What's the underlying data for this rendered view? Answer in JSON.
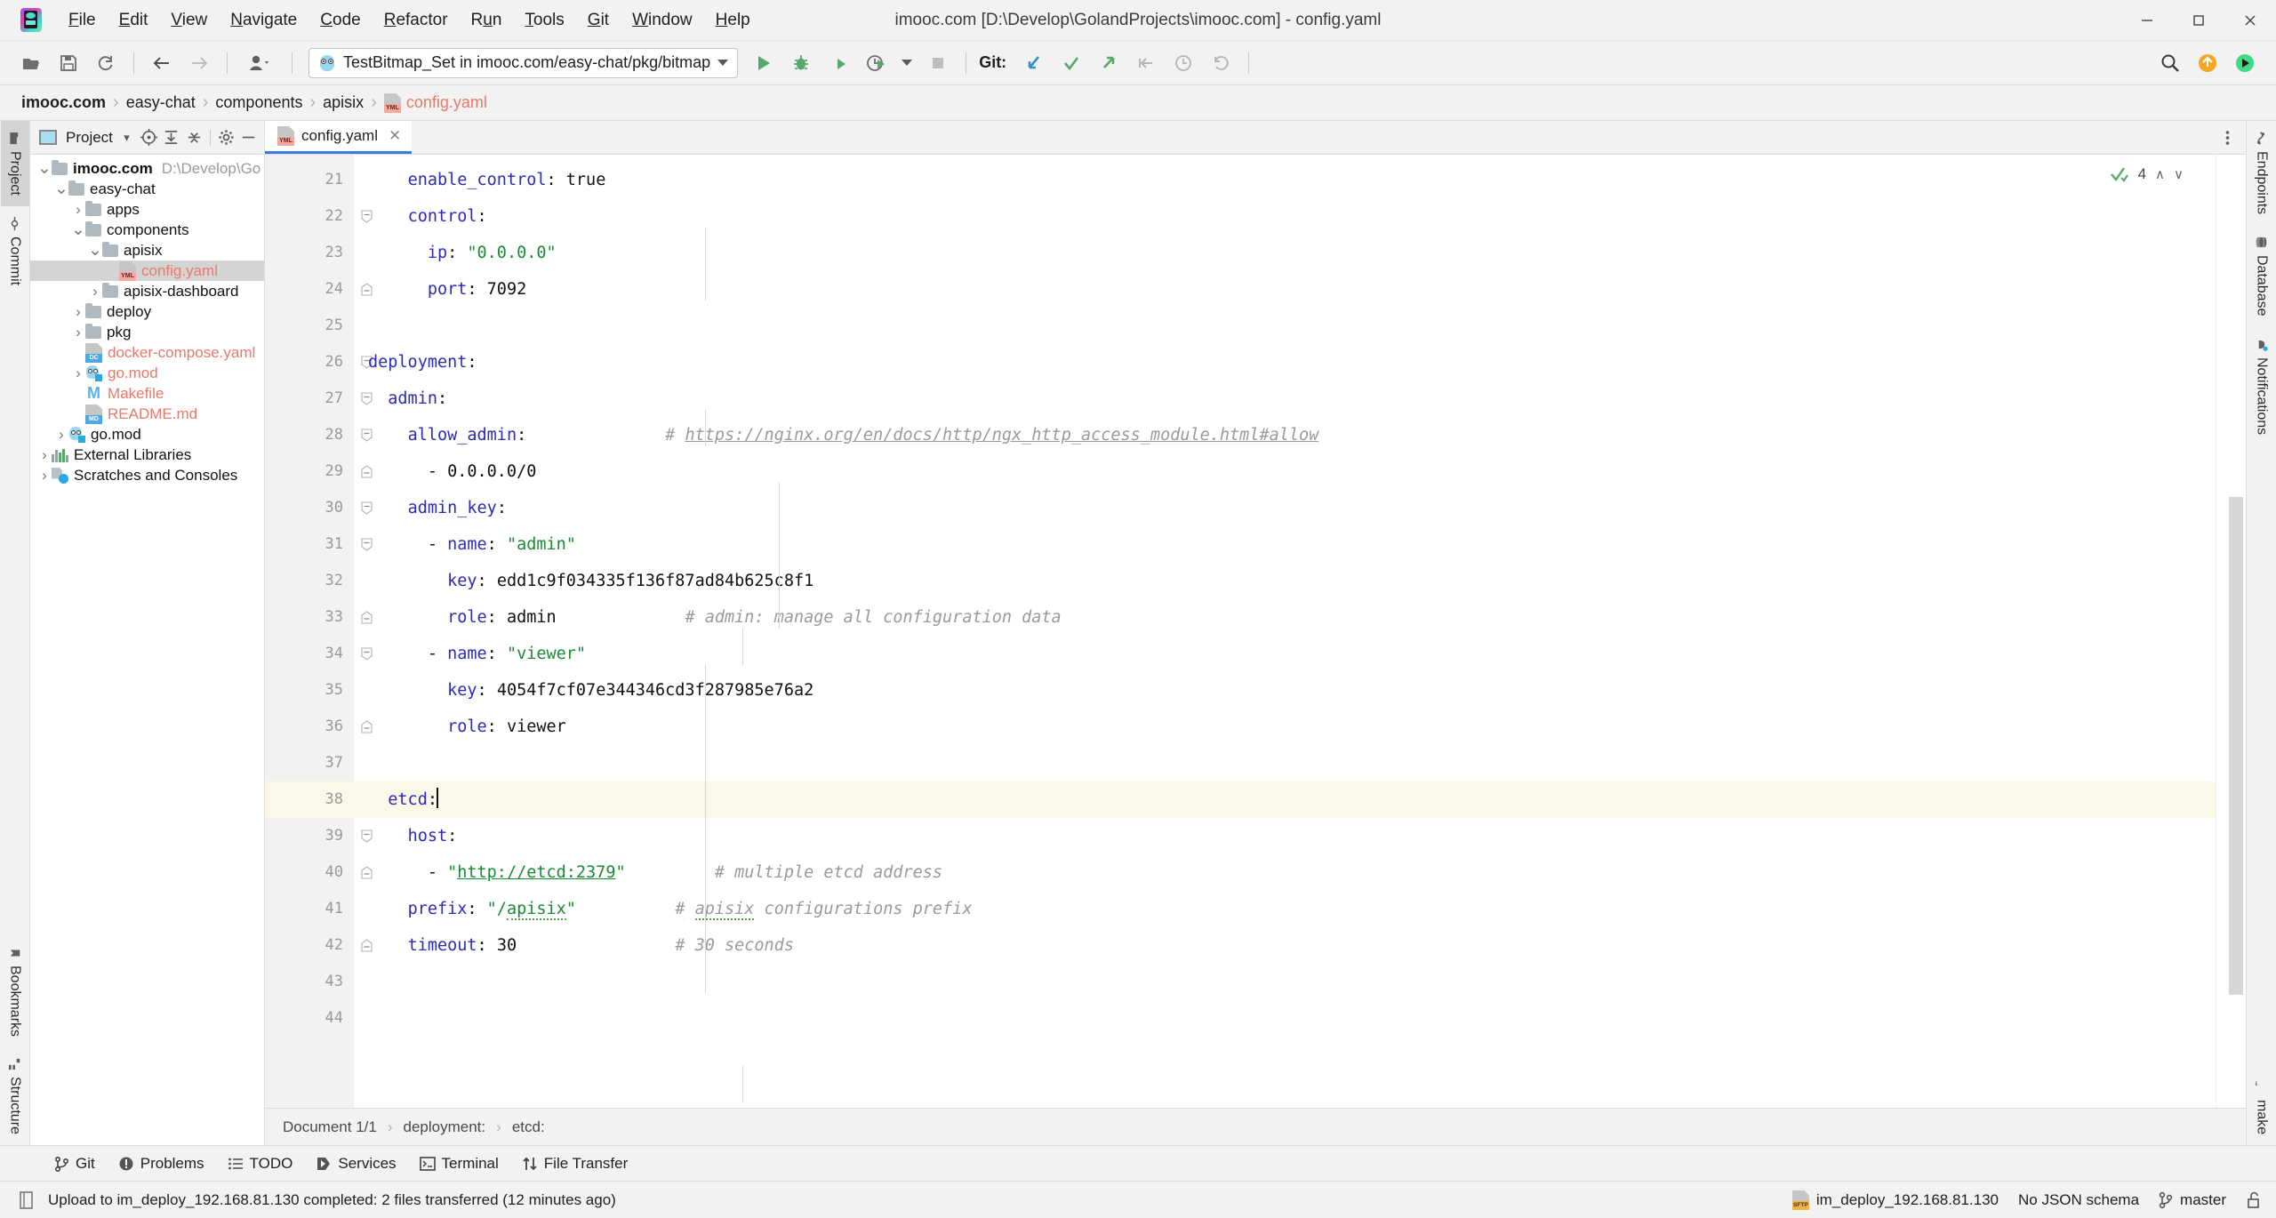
{
  "window": {
    "title": "imooc.com [D:\\Develop\\GolandProjects\\imooc.com] - config.yaml",
    "minimize": "─",
    "maximize": "❐",
    "close": "✕"
  },
  "menubar": {
    "items": [
      {
        "label": "File",
        "mnemonic": "F"
      },
      {
        "label": "Edit",
        "mnemonic": "E"
      },
      {
        "label": "View",
        "mnemonic": "V"
      },
      {
        "label": "Navigate",
        "mnemonic": "N"
      },
      {
        "label": "Code",
        "mnemonic": "C"
      },
      {
        "label": "Refactor",
        "mnemonic": "R"
      },
      {
        "label": "Run",
        "mnemonic": "u"
      },
      {
        "label": "Tools",
        "mnemonic": "T"
      },
      {
        "label": "Git",
        "mnemonic": "G"
      },
      {
        "label": "Window",
        "mnemonic": "W"
      },
      {
        "label": "Help",
        "mnemonic": "H"
      }
    ]
  },
  "toolbar": {
    "open_icon": "open-folder-icon",
    "save_icon": "save-icon",
    "sync_icon": "sync-icon",
    "back_icon": "back-arrow-icon",
    "forward_icon": "forward-arrow-icon",
    "profile_icon": "user-profile-icon",
    "run_config_label": "TestBitmap_Set in imooc.com/easy-chat/pkg/bitmap",
    "run_icon": "run-icon",
    "debug_icon": "debug-icon",
    "coverage_icon": "run-with-coverage-icon",
    "profiler_icon": "run-with-profiler-icon",
    "stop_icon": "stop-icon",
    "git_label": "Git:",
    "git_update_icon": "update-project-icon",
    "git_commit_icon": "commit-icon",
    "git_push_icon": "push-icon",
    "git_rebase_icon": "rebase-icon",
    "git_history_icon": "history-icon",
    "git_rollback_icon": "rollback-icon",
    "search_icon": "search-everywhere-icon",
    "updates_icon": "updates-available-icon",
    "ide_icon": "ide-indicator-icon"
  },
  "breadcrumb": {
    "items": [
      {
        "label": "imooc.com",
        "style": "bold"
      },
      {
        "label": "easy-chat",
        "style": "normal"
      },
      {
        "label": "components",
        "style": "normal"
      },
      {
        "label": "apisix",
        "style": "normal"
      },
      {
        "label": "config.yaml",
        "style": "file",
        "icon": "yaml-file-icon",
        "icon_tag": "YML"
      }
    ],
    "separator": "›"
  },
  "left_strip": {
    "tabs": [
      {
        "label": "Project",
        "icon": "project-icon",
        "active": true
      },
      {
        "label": "Commit",
        "icon": "commit-icon",
        "active": false
      }
    ],
    "bottom_tabs": [
      {
        "label": "Bookmarks",
        "icon": "bookmarks-icon"
      },
      {
        "label": "Structure",
        "icon": "structure-icon"
      }
    ]
  },
  "right_strip": {
    "tabs": [
      {
        "label": "Endpoints",
        "icon": "endpoints-icon"
      },
      {
        "label": "Database",
        "icon": "database-icon"
      },
      {
        "label": "Notifications",
        "icon": "notifications-icon"
      }
    ],
    "bottom_tabs": [
      {
        "label": "make",
        "icon": "make-icon"
      }
    ]
  },
  "project_panel": {
    "title": "Project",
    "title_caret": "▾",
    "buttons": [
      "select-opened-file-icon",
      "expand-all-icon",
      "collapse-all-icon",
      "settings-gear-icon",
      "hide-panel-icon"
    ],
    "tree": [
      {
        "label": "imooc.com",
        "path": "D:\\Develop\\GolandProje",
        "depth": 0,
        "arrow": "down",
        "icon": "folder",
        "bold": true
      },
      {
        "label": "easy-chat",
        "depth": 1,
        "arrow": "down",
        "icon": "folder"
      },
      {
        "label": "apps",
        "depth": 2,
        "arrow": "right",
        "icon": "folder"
      },
      {
        "label": "components",
        "depth": 2,
        "arrow": "down",
        "icon": "folder"
      },
      {
        "label": "apisix",
        "depth": 3,
        "arrow": "down",
        "icon": "folder"
      },
      {
        "label": "config.yaml",
        "depth": 4,
        "arrow": "none",
        "icon": "yml",
        "red": true,
        "selected": true
      },
      {
        "label": "apisix-dashboard",
        "depth": 3,
        "arrow": "right",
        "icon": "folder"
      },
      {
        "label": "deploy",
        "depth": 2,
        "arrow": "right",
        "icon": "folder"
      },
      {
        "label": "pkg",
        "depth": 2,
        "arrow": "right",
        "icon": "folder"
      },
      {
        "label": "docker-compose.yaml",
        "depth": 2,
        "arrow": "none",
        "icon": "dc",
        "red": true
      },
      {
        "label": "go.mod",
        "depth": 2,
        "arrow": "right",
        "icon": "gomod",
        "red": true
      },
      {
        "label": "Makefile",
        "depth": 2,
        "arrow": "none",
        "icon": "makefile",
        "red": true
      },
      {
        "label": "README.md",
        "depth": 2,
        "arrow": "none",
        "icon": "md",
        "red": true
      },
      {
        "label": "go.mod",
        "depth": 1,
        "arrow": "right",
        "icon": "gomod"
      },
      {
        "label": "External Libraries",
        "depth": 0,
        "arrow": "right",
        "icon": "library"
      },
      {
        "label": "Scratches and Consoles",
        "depth": 0,
        "arrow": "right",
        "icon": "scratches"
      }
    ]
  },
  "editor": {
    "tab": {
      "label": "config.yaml",
      "icon": "yaml-file-icon",
      "icon_tag": "YML",
      "close": "✕"
    },
    "options_icon": "editor-options-icon",
    "inspection": {
      "status_icon": "inspections-ok-icon",
      "count": "4",
      "up": "∧",
      "down": "∨"
    },
    "first_line_number": 21,
    "lines": [
      {
        "n": 21,
        "tokens": [
          {
            "t": "    ",
            "c": "v"
          },
          {
            "t": "enable_control",
            "c": "k"
          },
          {
            "t": ": ",
            "c": "v"
          },
          {
            "t": "true",
            "c": "v"
          }
        ],
        "fold": "none"
      },
      {
        "n": 22,
        "tokens": [
          {
            "t": "    ",
            "c": "v"
          },
          {
            "t": "control",
            "c": "k"
          },
          {
            "t": ":",
            "c": "v"
          }
        ],
        "fold": "open"
      },
      {
        "n": 23,
        "tokens": [
          {
            "t": "      ",
            "c": "v"
          },
          {
            "t": "ip",
            "c": "k"
          },
          {
            "t": ": ",
            "c": "v"
          },
          {
            "t": "\"0.0.0.0\"",
            "c": "s"
          }
        ],
        "fold": "none"
      },
      {
        "n": 24,
        "tokens": [
          {
            "t": "      ",
            "c": "v"
          },
          {
            "t": "port",
            "c": "k"
          },
          {
            "t": ": ",
            "c": "v"
          },
          {
            "t": "7092",
            "c": "v"
          }
        ],
        "fold": "end"
      },
      {
        "n": 25,
        "tokens": [],
        "fold": "none"
      },
      {
        "n": 26,
        "tokens": [
          {
            "t": "deployment",
            "c": "k"
          },
          {
            "t": ":",
            "c": "v"
          }
        ],
        "fold": "open"
      },
      {
        "n": 27,
        "tokens": [
          {
            "t": "  ",
            "c": "v"
          },
          {
            "t": "admin",
            "c": "k"
          },
          {
            "t": ":",
            "c": "v"
          }
        ],
        "fold": "open"
      },
      {
        "n": 28,
        "tokens": [
          {
            "t": "    ",
            "c": "v"
          },
          {
            "t": "allow_admin",
            "c": "k"
          },
          {
            "t": ":",
            "c": "v"
          },
          {
            "t": "              ",
            "c": "v"
          },
          {
            "t": "# ",
            "c": "c"
          },
          {
            "t": "https://nginx.org/en/docs/http/ngx_http_access_module.html#allow",
            "c": "c-link"
          }
        ],
        "fold": "open"
      },
      {
        "n": 29,
        "tokens": [
          {
            "t": "      - ",
            "c": "v"
          },
          {
            "t": "0.0.0.0/0",
            "c": "v"
          }
        ],
        "fold": "end"
      },
      {
        "n": 30,
        "tokens": [
          {
            "t": "    ",
            "c": "v"
          },
          {
            "t": "admin_key",
            "c": "k"
          },
          {
            "t": ":",
            "c": "v"
          }
        ],
        "fold": "open"
      },
      {
        "n": 31,
        "tokens": [
          {
            "t": "      - ",
            "c": "v"
          },
          {
            "t": "name",
            "c": "k"
          },
          {
            "t": ": ",
            "c": "v"
          },
          {
            "t": "\"admin\"",
            "c": "s"
          }
        ],
        "fold": "open"
      },
      {
        "n": 32,
        "tokens": [
          {
            "t": "        ",
            "c": "v"
          },
          {
            "t": "key",
            "c": "k"
          },
          {
            "t": ": ",
            "c": "v"
          },
          {
            "t": "edd1c9f034335f136f87ad84b625c8f1",
            "c": "v"
          }
        ],
        "fold": "none"
      },
      {
        "n": 33,
        "tokens": [
          {
            "t": "        ",
            "c": "v"
          },
          {
            "t": "role",
            "c": "k"
          },
          {
            "t": ": ",
            "c": "v"
          },
          {
            "t": "admin",
            "c": "v"
          },
          {
            "t": "             ",
            "c": "v"
          },
          {
            "t": "# admin: manage all configuration data",
            "c": "c"
          }
        ],
        "fold": "end"
      },
      {
        "n": 34,
        "tokens": [
          {
            "t": "      - ",
            "c": "v"
          },
          {
            "t": "name",
            "c": "k"
          },
          {
            "t": ": ",
            "c": "v"
          },
          {
            "t": "\"viewer\"",
            "c": "s"
          }
        ],
        "fold": "open"
      },
      {
        "n": 35,
        "tokens": [
          {
            "t": "        ",
            "c": "v"
          },
          {
            "t": "key",
            "c": "k"
          },
          {
            "t": ": ",
            "c": "v"
          },
          {
            "t": "4054f7cf07e344346cd3f287985e76a2",
            "c": "v"
          }
        ],
        "fold": "none"
      },
      {
        "n": 36,
        "tokens": [
          {
            "t": "        ",
            "c": "v"
          },
          {
            "t": "role",
            "c": "k"
          },
          {
            "t": ": ",
            "c": "v"
          },
          {
            "t": "viewer",
            "c": "v"
          }
        ],
        "fold": "end"
      },
      {
        "n": 37,
        "tokens": [],
        "fold": "none"
      },
      {
        "n": 38,
        "tokens": [
          {
            "t": "  ",
            "c": "v"
          },
          {
            "t": "etcd",
            "c": "k"
          },
          {
            "t": ":",
            "c": "v"
          },
          {
            "t": "",
            "c": "caret"
          }
        ],
        "fold": "open",
        "highlight": true
      },
      {
        "n": 39,
        "tokens": [
          {
            "t": "    ",
            "c": "v"
          },
          {
            "t": "host",
            "c": "k"
          },
          {
            "t": ":",
            "c": "v"
          }
        ],
        "fold": "open"
      },
      {
        "n": 40,
        "tokens": [
          {
            "t": "      - ",
            "c": "v"
          },
          {
            "t": "\"",
            "c": "s"
          },
          {
            "t": "http://etcd:2379",
            "c": "link"
          },
          {
            "t": "\"",
            "c": "s"
          },
          {
            "t": "         ",
            "c": "v"
          },
          {
            "t": "# multiple etcd address",
            "c": "c"
          }
        ],
        "fold": "end"
      },
      {
        "n": 41,
        "tokens": [
          {
            "t": "    ",
            "c": "v"
          },
          {
            "t": "prefix",
            "c": "k"
          },
          {
            "t": ": ",
            "c": "v"
          },
          {
            "t": "\"/",
            "c": "s"
          },
          {
            "t": "apisix",
            "c": "s-typo"
          },
          {
            "t": "\"",
            "c": "s"
          },
          {
            "t": "          ",
            "c": "v"
          },
          {
            "t": "# ",
            "c": "c"
          },
          {
            "t": "apisix",
            "c": "c-typo"
          },
          {
            "t": " configurations prefix",
            "c": "c"
          }
        ],
        "fold": "none"
      },
      {
        "n": 42,
        "tokens": [
          {
            "t": "    ",
            "c": "v"
          },
          {
            "t": "timeout",
            "c": "k"
          },
          {
            "t": ": ",
            "c": "v"
          },
          {
            "t": "30",
            "c": "v"
          },
          {
            "t": "                ",
            "c": "v"
          },
          {
            "t": "# 30 seconds",
            "c": "c"
          }
        ],
        "fold": "end"
      },
      {
        "n": 43,
        "tokens": [],
        "fold": "none"
      },
      {
        "n": 44,
        "tokens": [],
        "fold": "none"
      }
    ]
  },
  "doc_status": {
    "document": "Document 1/1",
    "sep": "›",
    "crumbs": [
      "deployment:",
      "etcd:"
    ]
  },
  "toolwindow_bar": {
    "items": [
      {
        "label": "Git",
        "icon": "git-branch-icon"
      },
      {
        "label": "Problems",
        "icon": "problems-icon"
      },
      {
        "label": "TODO",
        "icon": "todo-icon"
      },
      {
        "label": "Services",
        "icon": "services-icon"
      },
      {
        "label": "Terminal",
        "icon": "terminal-icon"
      },
      {
        "label": "File Transfer",
        "icon": "file-transfer-icon"
      }
    ]
  },
  "statusbar": {
    "message_icon": "event-log-icon",
    "message": "Upload to im_deploy_192.168.81.130 completed: 2 files transferred (12 minutes ago)",
    "sftp": {
      "icon": "sftp-icon",
      "icon_tag": "SFTP",
      "label": "im_deploy_192.168.81.130"
    },
    "schema": "No JSON schema",
    "branch": {
      "icon": "git-branch-icon",
      "label": "master"
    },
    "lock_icon": "unlocked-icon"
  },
  "colors": {
    "accent_blue": "#3a7fd5",
    "key_blue": "#2b2bb5",
    "string_green": "#1a8a33",
    "comment_gray": "#9a9a9a",
    "file_red": "#e8796b",
    "caret_line": "#fbf8e8",
    "selection_gray": "#d4d4d4"
  }
}
